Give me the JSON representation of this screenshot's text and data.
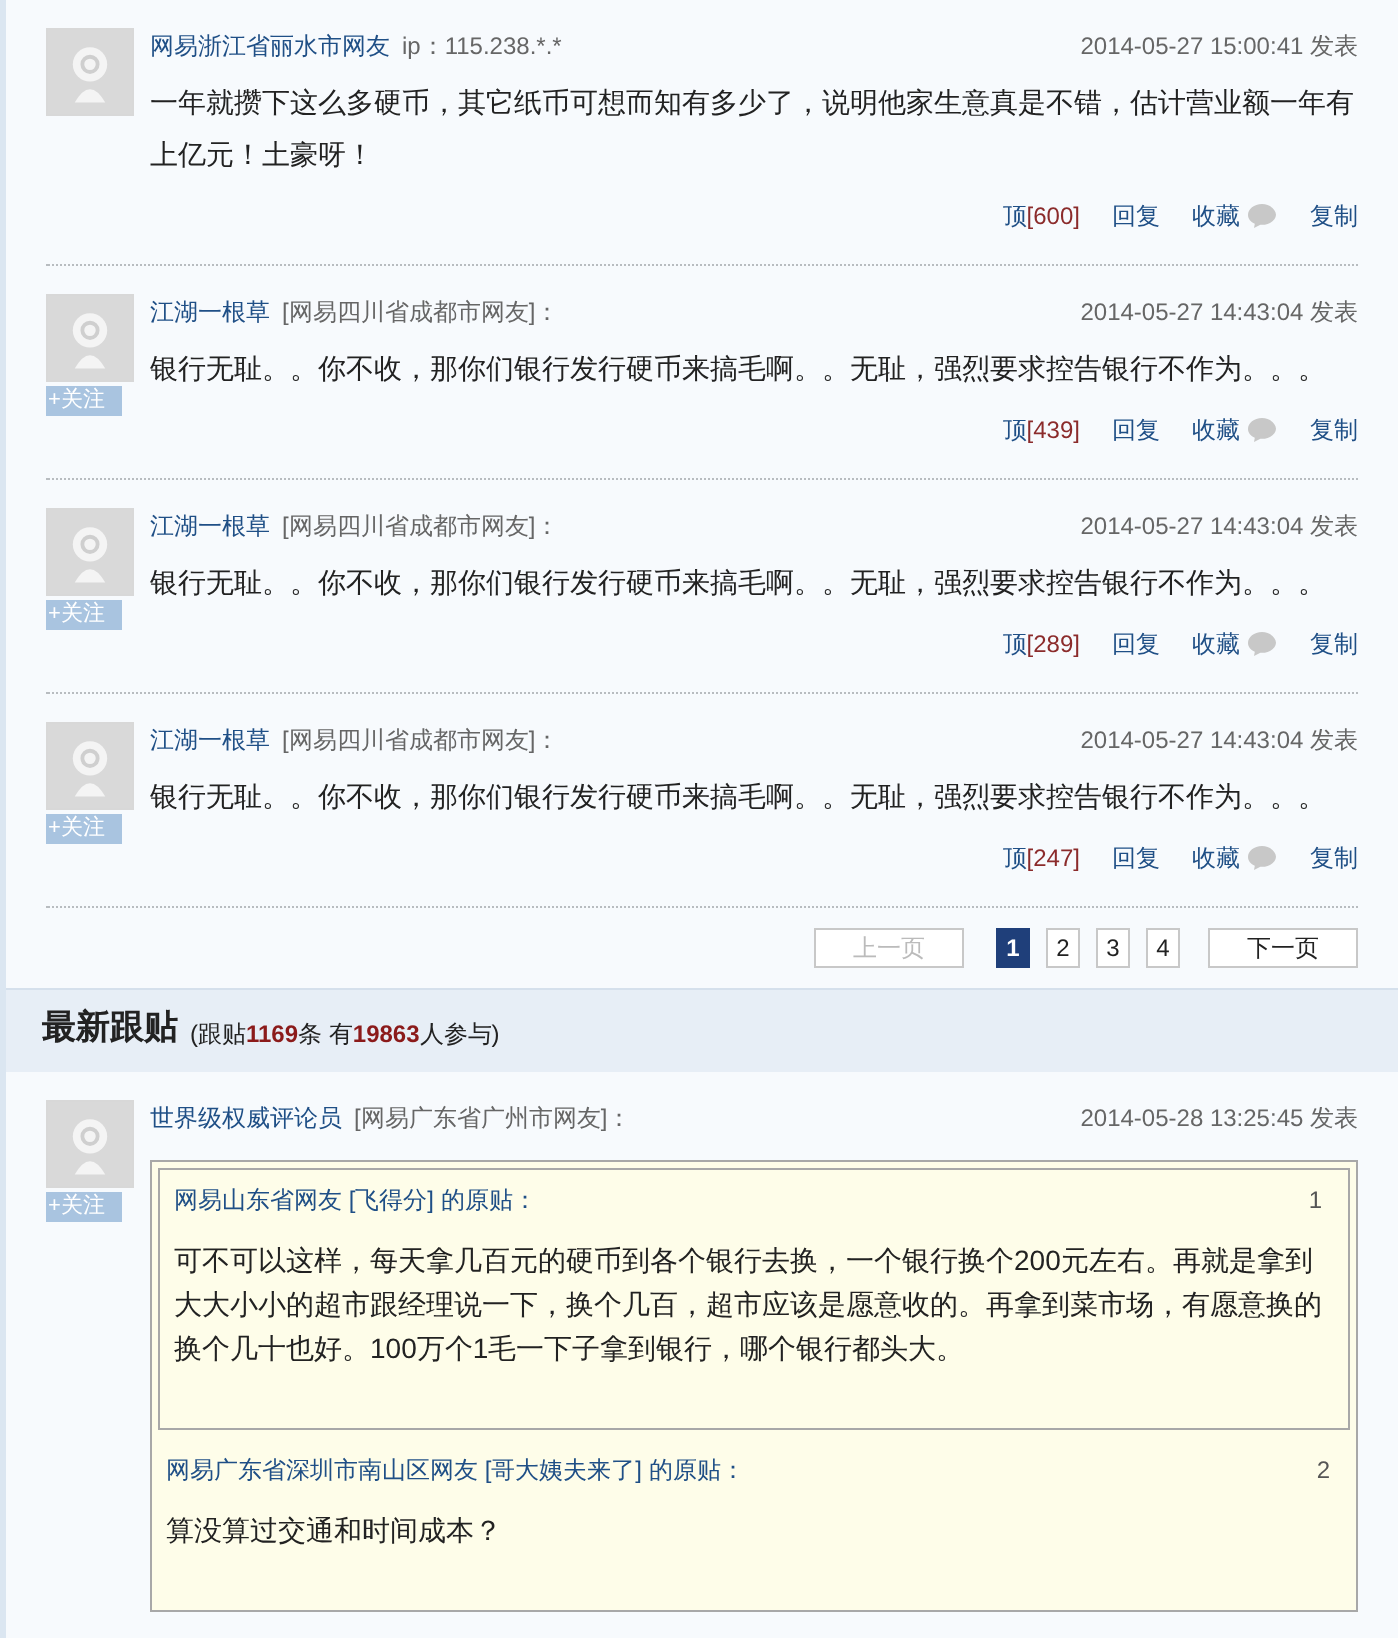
{
  "comments": [
    {
      "author": "网易浙江省丽水市网友",
      "author_note": "ip：115.238.*.*",
      "time": "2014-05-27 15:00:41 发表",
      "body": "一年就攒下这么多硬币，其它纸币可想而知有多少了，说明他家生意真是不错，估计营业额一年有上亿元！土豪呀！",
      "actions": {
        "up": "顶",
        "up_count": "[600]",
        "reply": "回复",
        "save": "收藏",
        "copy": "复制"
      }
    },
    {
      "author": "江湖一根草",
      "author_note": "[网易四川省成都市网友]：",
      "follow": "+关注",
      "time": "2014-05-27 14:43:04 发表",
      "body": "银行无耻。。你不收，那你们银行发行硬币来搞毛啊。。无耻，强烈要求控告银行不作为。。。",
      "actions": {
        "up": "顶",
        "up_count": "[439]",
        "reply": "回复",
        "save": "收藏",
        "copy": "复制"
      }
    },
    {
      "author": "江湖一根草",
      "author_note": "[网易四川省成都市网友]：",
      "follow": "+关注",
      "time": "2014-05-27 14:43:04 发表",
      "body": "银行无耻。。你不收，那你们银行发行硬币来搞毛啊。。无耻，强烈要求控告银行不作为。。。",
      "actions": {
        "up": "顶",
        "up_count": "[289]",
        "reply": "回复",
        "save": "收藏",
        "copy": "复制"
      }
    },
    {
      "author": "江湖一根草",
      "author_note": "[网易四川省成都市网友]：",
      "follow": "+关注",
      "time": "2014-05-27 14:43:04 发表",
      "body": "银行无耻。。你不收，那你们银行发行硬币来搞毛啊。。无耻，强烈要求控告银行不作为。。。",
      "actions": {
        "up": "顶",
        "up_count": "[247]",
        "reply": "回复",
        "save": "收藏",
        "copy": "复制"
      }
    }
  ],
  "pagination": {
    "prev": {
      "label": "上一页",
      "disabled": true
    },
    "pages": [
      {
        "label": "1",
        "selected": true
      },
      {
        "label": "2",
        "selected": false
      },
      {
        "label": "3",
        "selected": false
      },
      {
        "label": "4",
        "selected": false
      }
    ],
    "next": {
      "label": "下一页",
      "disabled": false
    }
  },
  "latest": {
    "title": "最新跟贴",
    "summary": "(跟贴**1169**条 有**19863**人参与)",
    "comments": [
      {
        "author": "世界级权威评论员",
        "author_note": "[网易广东省广州市网友]：",
        "follow": "+关注",
        "time": "2014-05-28 13:25:45 发表",
        "quote": {
          "header": "网易广东省深圳市南山区网友 [哥大姨夫来了] 的原贴：",
          "number": "2",
          "body": "算没算过交通和时间成本？",
          "children": [
            {
              "header": "网易山东省网友 [飞得分] 的原贴：",
              "number": "1",
              "body": "可不可以这样，每天拿几百元的硬币到各个银行去换，一个银行换个200元左右。再就是拿到大大小小的超市跟经理说一下，换个几百，超市应该是愿意收的。再拿到菜市场，有愿意换的换个几十也好。100万个1毛一下子拿到银行，哪个银行都头大。"
            }
          ]
        }
      }
    ]
  }
}
